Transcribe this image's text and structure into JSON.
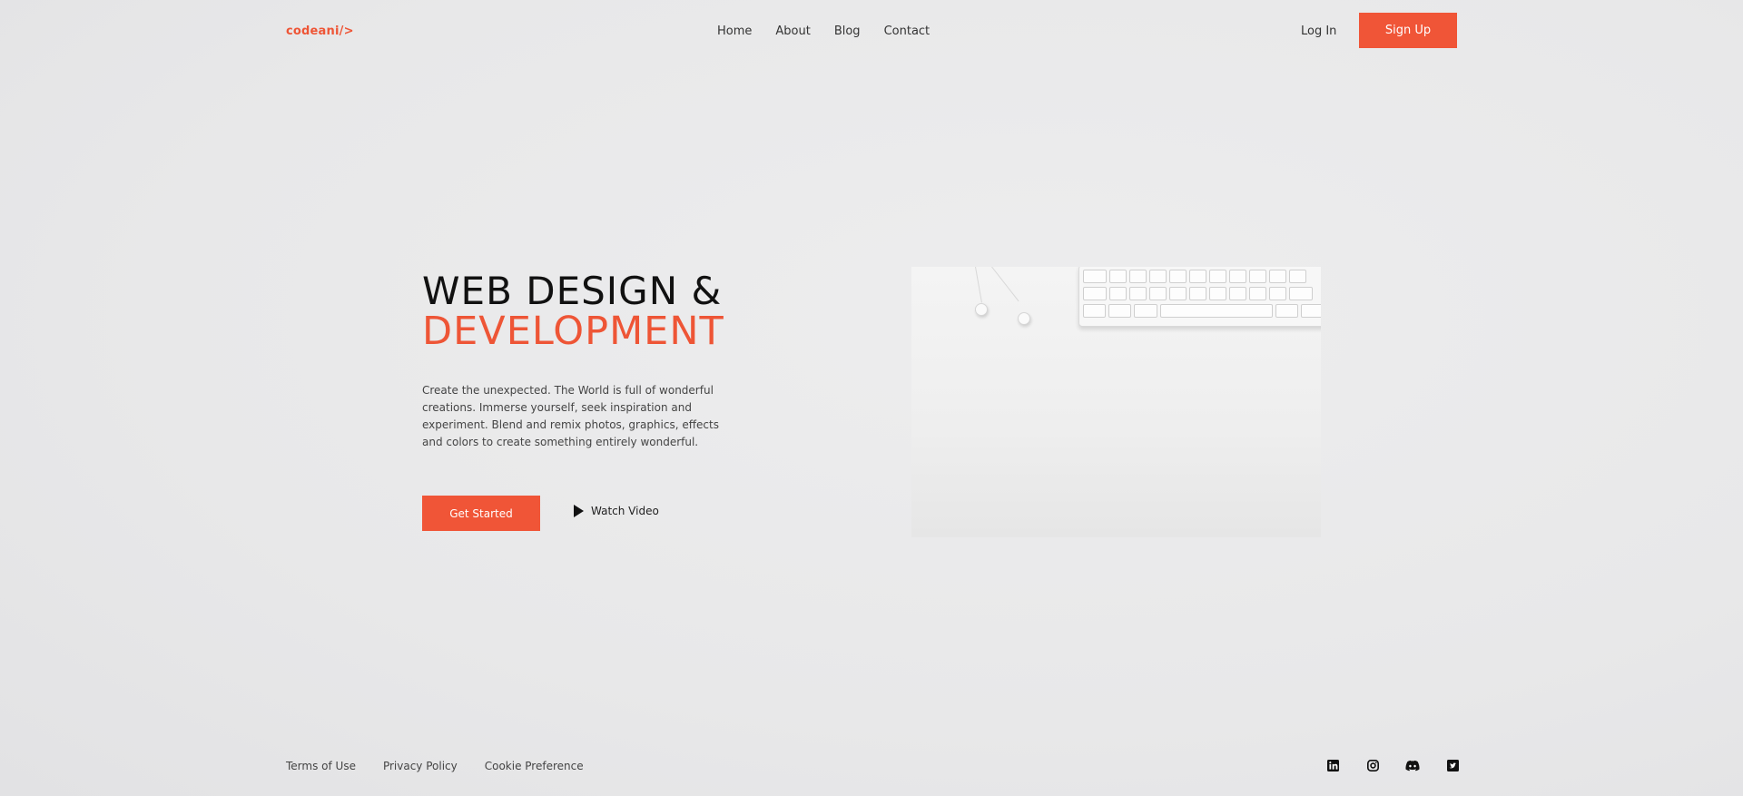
{
  "header": {
    "logo": "codeani/>",
    "nav": [
      "Home",
      "About",
      "Blog",
      "Contact"
    ],
    "login_label": "Log In",
    "signup_label": "Sign Up"
  },
  "hero": {
    "title_line1": "WEB DESIGN &",
    "title_line2": "DEVELOPMENT",
    "description": "Create the unexpected. The World is full of wonderful creations. Immerse yourself, seek inspiration and experiment. Blend and remix photos, graphics, effects and colors to create something entirely wonderful.",
    "get_started_label": "Get Started",
    "watch_video_label": "Watch Video"
  },
  "footer": {
    "links": [
      "Terms of Use",
      "Privacy Policy",
      "Cookie Preference"
    ],
    "social_icons": [
      "linkedin-icon",
      "instagram-icon",
      "discord-icon",
      "twitter-icon"
    ]
  },
  "colors": {
    "accent": "#f05537",
    "text": "#222222",
    "background": "#e9e9ea"
  }
}
